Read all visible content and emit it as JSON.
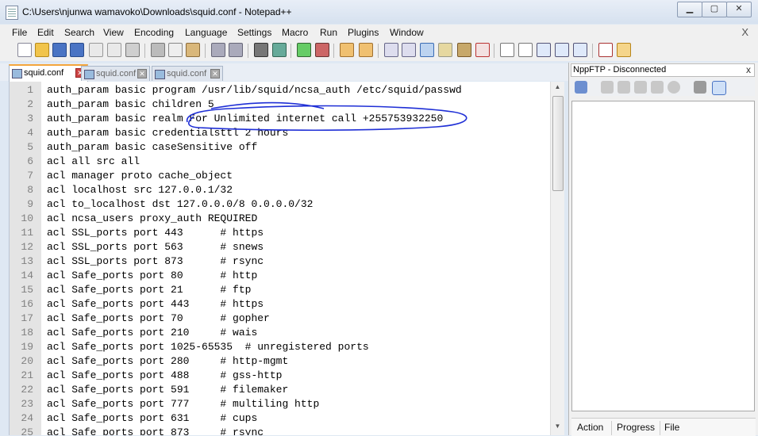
{
  "window": {
    "title": "C:\\Users\\njunwa wamavoko\\Downloads\\squid.conf - Notepad++",
    "btn_min": "▁",
    "btn_max": "▢",
    "btn_close": "✕"
  },
  "menu": {
    "items": [
      "File",
      "Edit",
      "Search",
      "View",
      "Encoding",
      "Language",
      "Settings",
      "Macro",
      "Run",
      "Plugins",
      "Window"
    ],
    "close": "X"
  },
  "tabs": [
    {
      "label": "squid.conf",
      "active": true
    },
    {
      "label": "squid.conf",
      "active": false
    },
    {
      "label": "squid.conf",
      "active": false
    }
  ],
  "editor": {
    "lines": [
      {
        "n": "1",
        "text": "auth_param basic program /usr/lib/squid/ncsa_auth /etc/squid/passwd"
      },
      {
        "n": "2",
        "text": "auth_param basic children 5"
      },
      {
        "n": "3",
        "text": "auth_param basic realm For Unlimited internet call +255753932250"
      },
      {
        "n": "4",
        "text": "auth_param basic credentialsttl 2 hours"
      },
      {
        "n": "5",
        "text": "auth_param basic caseSensitive off"
      },
      {
        "n": "6",
        "text": "acl all src all"
      },
      {
        "n": "7",
        "text": "acl manager proto cache_object"
      },
      {
        "n": "8",
        "text": "acl localhost src 127.0.0.1/32"
      },
      {
        "n": "9",
        "text": "acl to_localhost dst 127.0.0.0/8 0.0.0.0/32"
      },
      {
        "n": "10",
        "text": "acl ncsa_users proxy_auth REQUIRED"
      },
      {
        "n": "11",
        "text": "acl SSL_ports port 443      # https"
      },
      {
        "n": "12",
        "text": "acl SSL_ports port 563      # snews"
      },
      {
        "n": "13",
        "text": "acl SSL_ports port 873      # rsync"
      },
      {
        "n": "14",
        "text": "acl Safe_ports port 80      # http"
      },
      {
        "n": "15",
        "text": "acl Safe_ports port 21      # ftp"
      },
      {
        "n": "16",
        "text": "acl Safe_ports port 443     # https"
      },
      {
        "n": "17",
        "text": "acl Safe_ports port 70      # gopher"
      },
      {
        "n": "18",
        "text": "acl Safe_ports port 210     # wais"
      },
      {
        "n": "19",
        "text": "acl Safe_ports port 1025-65535  # unregistered ports"
      },
      {
        "n": "20",
        "text": "acl Safe_ports port 280     # http-mgmt"
      },
      {
        "n": "21",
        "text": "acl Safe_ports port 488     # gss-http"
      },
      {
        "n": "22",
        "text": "acl Safe_ports port 591     # filemaker"
      },
      {
        "n": "23",
        "text": "acl Safe_ports port 777     # multiling http"
      },
      {
        "n": "24",
        "text": "acl Safe_ports port 631     # cups"
      },
      {
        "n": "25",
        "text": "acl Safe_ports port 873     # rsync"
      }
    ]
  },
  "ftp_panel": {
    "title": "NppFTP - Disconnected",
    "close": "x",
    "bottom_tabs": [
      "Action",
      "Progress",
      "File"
    ]
  },
  "colors": {
    "tab_accent": "#f3a53c",
    "ink_annotation": "#1f2fd6",
    "line_numbers": "#808080"
  }
}
